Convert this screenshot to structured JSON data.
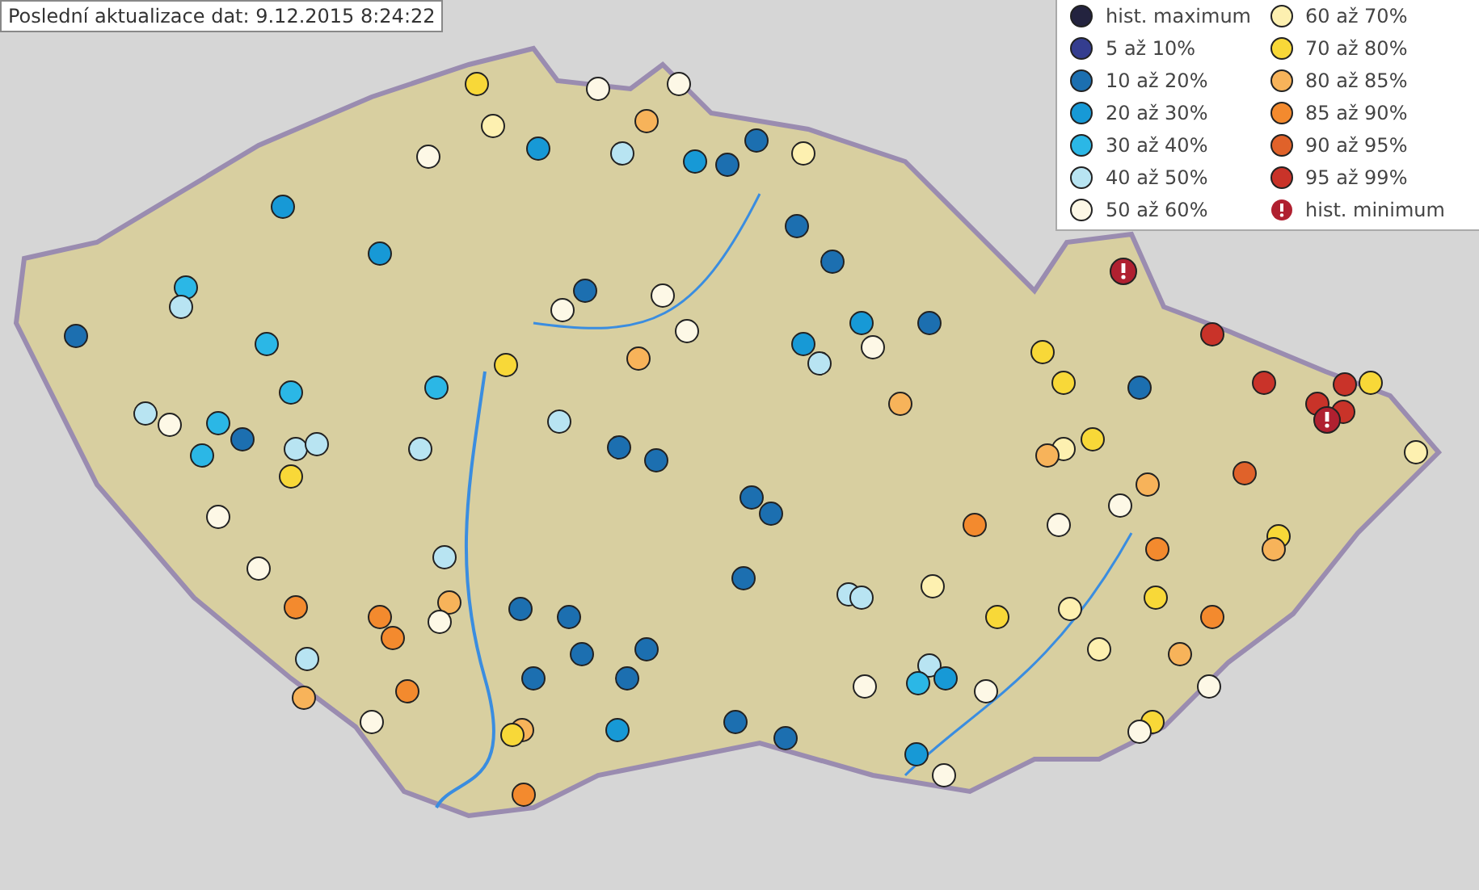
{
  "update_label": "Poslední aktualizace dat: 9.12.2015 8:24:22",
  "legend": [
    {
      "label": "hist. maximum",
      "color": "#23233f",
      "kind": "dot"
    },
    {
      "label": "5 až 10%",
      "color": "#343d8f",
      "kind": "dot"
    },
    {
      "label": "10 až 20%",
      "color": "#1c6fb0",
      "kind": "dot"
    },
    {
      "label": "20 až 30%",
      "color": "#1799d6",
      "kind": "dot"
    },
    {
      "label": "30 až 40%",
      "color": "#2bb7e6",
      "kind": "dot"
    },
    {
      "label": "40 až 50%",
      "color": "#b8e4f2",
      "kind": "dot"
    },
    {
      "label": "50 až 60%",
      "color": "#fdf8e6",
      "kind": "dot"
    },
    {
      "label": "60 až 70%",
      "color": "#fdf0b0",
      "kind": "dot"
    },
    {
      "label": "70 až 80%",
      "color": "#f8d838",
      "kind": "dot"
    },
    {
      "label": "80 až 85%",
      "color": "#f7b35a",
      "kind": "dot"
    },
    {
      "label": "85 až 90%",
      "color": "#f38a2e",
      "kind": "dot"
    },
    {
      "label": "90 až 95%",
      "color": "#e0622a",
      "kind": "dot"
    },
    {
      "label": "95 až 99%",
      "color": "#c93329",
      "kind": "dot"
    },
    {
      "label": "hist. minimum",
      "color": "#b02030",
      "kind": "alert"
    }
  ]
}
